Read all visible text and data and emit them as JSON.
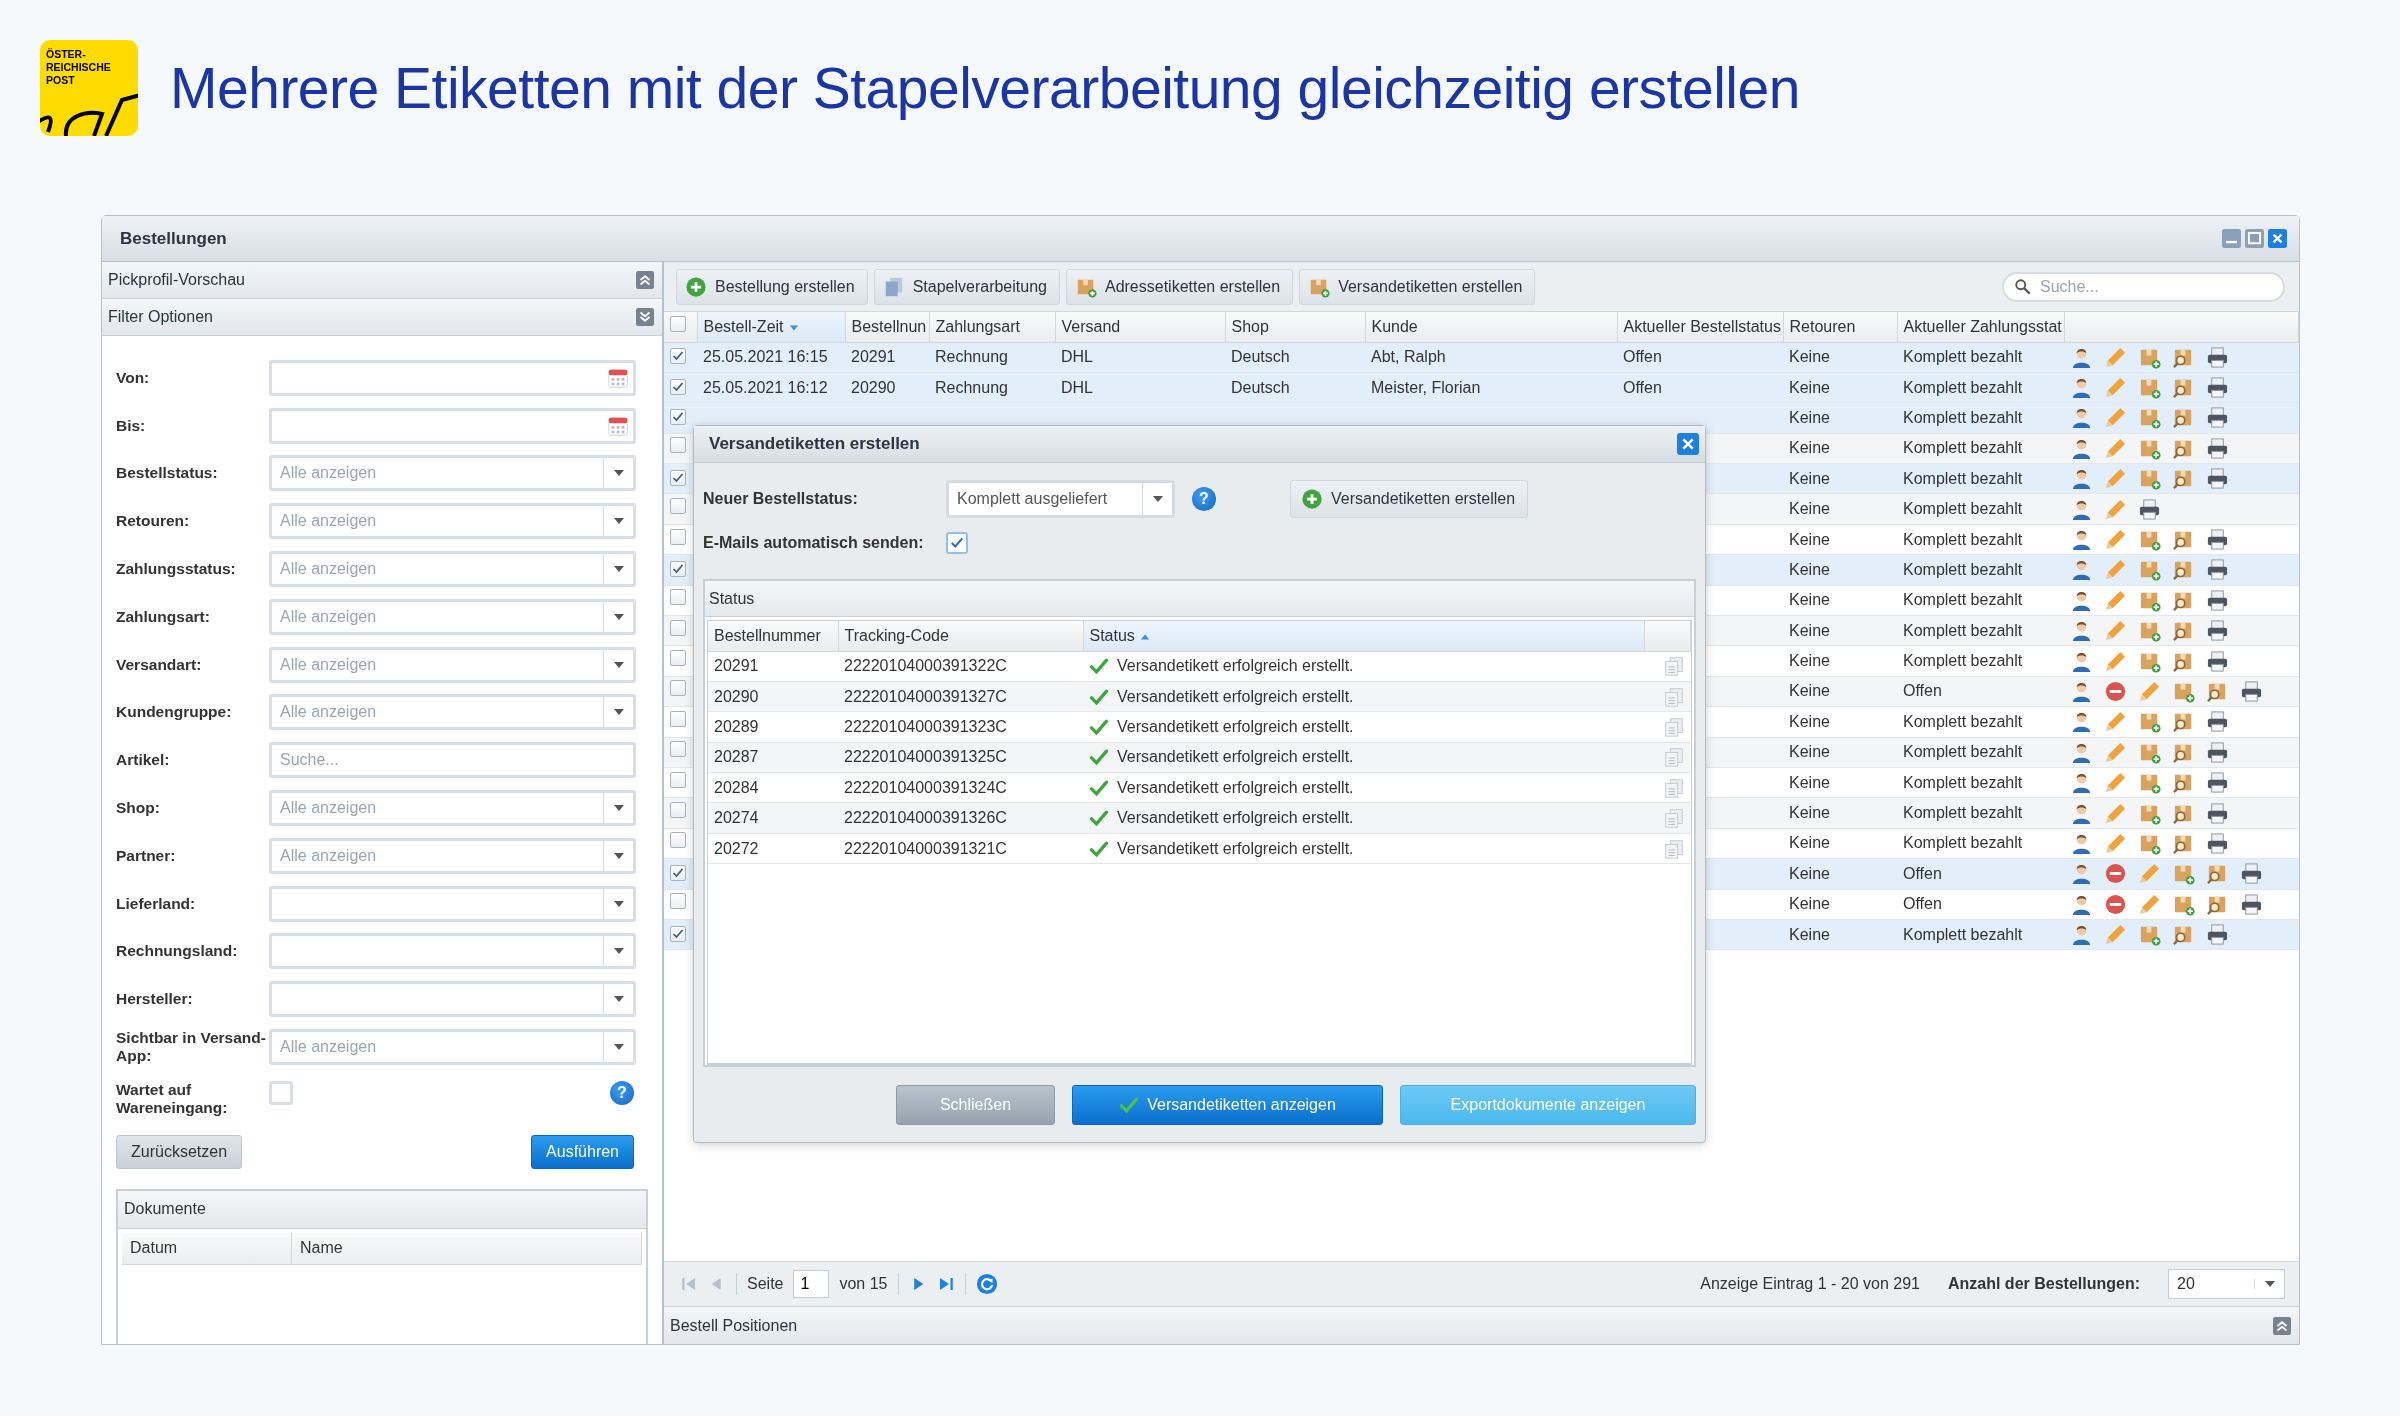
{
  "header": {
    "logo_lines": [
      "ÖSTER-",
      "REICHISCHE",
      "POST"
    ],
    "title": "Mehrere Etiketten mit der Stapelverarbeitung gleichzeitig erstellen"
  },
  "window": {
    "title": "Bestellungen"
  },
  "sidebar": {
    "panels": [
      {
        "title": "Pickprofil-Vorschau",
        "expanded": false
      },
      {
        "title": "Filter Optionen",
        "expanded": true
      }
    ],
    "filters": [
      {
        "label": "Von:",
        "kind": "date"
      },
      {
        "label": "Bis:",
        "kind": "date"
      },
      {
        "label": "Bestellstatus:",
        "kind": "select",
        "placeholder": "Alle anzeigen"
      },
      {
        "label": "Retouren:",
        "kind": "select",
        "placeholder": "Alle anzeigen"
      },
      {
        "label": "Zahlungsstatus:",
        "kind": "select",
        "placeholder": "Alle anzeigen"
      },
      {
        "label": "Zahlungsart:",
        "kind": "select",
        "placeholder": "Alle anzeigen"
      },
      {
        "label": "Versandart:",
        "kind": "select",
        "placeholder": "Alle anzeigen"
      },
      {
        "label": "Kundengruppe:",
        "kind": "select",
        "placeholder": "Alle anzeigen"
      },
      {
        "label": "Artikel:",
        "kind": "text",
        "placeholder": "Suche..."
      },
      {
        "label": "Shop:",
        "kind": "select",
        "placeholder": "Alle anzeigen"
      },
      {
        "label": "Partner:",
        "kind": "select",
        "placeholder": "Alle anzeigen"
      },
      {
        "label": "Lieferland:",
        "kind": "select"
      },
      {
        "label": "Rechnungsland:",
        "kind": "select"
      },
      {
        "label": "Hersteller:",
        "kind": "select"
      },
      {
        "label": "Sichtbar in Versand-App:",
        "kind": "select",
        "placeholder": "Alle anzeigen"
      },
      {
        "label": "Wartet auf Wareneingang:",
        "kind": "checkbox",
        "checked": false,
        "help": "?"
      }
    ],
    "buttons": [
      {
        "label": "Zurücksetzen",
        "kind": "default"
      },
      {
        "label": "Ausführen",
        "kind": "primary"
      }
    ],
    "documents": {
      "title": "Dokumente",
      "columns": [
        "Datum",
        "Name"
      ]
    }
  },
  "toolbar": {
    "buttons": [
      {
        "label": "Bestellung erstellen",
        "kind": "plus"
      },
      {
        "label": "Stapelverarbeitung",
        "kind": "pages"
      },
      {
        "label": "Adressetiketten erstellen",
        "kind": "package"
      },
      {
        "label": "Versandetiketten erstellen",
        "kind": "package"
      }
    ],
    "search": {
      "placeholder": "Suche..."
    }
  },
  "table": {
    "select_all_checked": false,
    "columns": [
      {
        "label": "Bestell-Zeit",
        "sorted": true,
        "descending": true
      },
      {
        "label": "Bestellnun",
        "sorted": false
      },
      {
        "label": "Zahlungsart",
        "sorted": false
      },
      {
        "label": "Versand",
        "sorted": false
      },
      {
        "label": "Shop",
        "sorted": false
      },
      {
        "label": "Kunde",
        "sorted": false
      },
      {
        "label": "Aktueller Bestellstatus",
        "sorted": false
      },
      {
        "label": "Retouren",
        "sorted": false
      },
      {
        "label": "Aktueller Zahlungsstat",
        "sorted": false
      }
    ],
    "rows": [
      {
        "checked": true,
        "bestell_zeit": "25.05.2021 16:15",
        "bestellnummer": "20291",
        "zahlungsart": "Rechnung",
        "versand": "DHL",
        "shop": "Deutsch",
        "kunde": "Abt, Ralph",
        "bestellstatus": "Offen",
        "retouren": "Keine",
        "zahlungsstatus": "Komplett bezahlt",
        "actions": [
          {
            "kind": "customer"
          },
          {
            "kind": "edit"
          },
          {
            "kind": "address-label"
          },
          {
            "kind": "shipping-label"
          },
          {
            "kind": "print"
          }
        ]
      },
      {
        "checked": true,
        "bestell_zeit": "25.05.2021 16:12",
        "bestellnummer": "20290",
        "zahlungsart": "Rechnung",
        "versand": "DHL",
        "shop": "Deutsch",
        "kunde": "Meister, Florian",
        "bestellstatus": "Offen",
        "retouren": "Keine",
        "zahlungsstatus": "Komplett bezahlt",
        "actions": [
          {
            "kind": "customer"
          },
          {
            "kind": "edit"
          },
          {
            "kind": "address-label"
          },
          {
            "kind": "shipping-label"
          },
          {
            "kind": "print"
          }
        ]
      },
      {
        "checked": true,
        "retouren": "Keine",
        "zahlungsstatus": "Komplett bezahlt",
        "actions": [
          {
            "kind": "customer"
          },
          {
            "kind": "edit"
          },
          {
            "kind": "address-label"
          },
          {
            "kind": "shipping-label"
          },
          {
            "kind": "print"
          }
        ]
      },
      {
        "checked": false,
        "retouren": "Keine",
        "zahlungsstatus": "Komplett bezahlt",
        "actions": [
          {
            "kind": "customer"
          },
          {
            "kind": "edit"
          },
          {
            "kind": "address-label"
          },
          {
            "kind": "shipping-label"
          },
          {
            "kind": "print"
          }
        ]
      },
      {
        "checked": true,
        "retouren": "Keine",
        "zahlungsstatus": "Komplett bezahlt",
        "actions": [
          {
            "kind": "customer"
          },
          {
            "kind": "edit"
          },
          {
            "kind": "address-label"
          },
          {
            "kind": "shipping-label"
          },
          {
            "kind": "print"
          }
        ]
      },
      {
        "checked": false,
        "retouren": "Keine",
        "zahlungsstatus": "Komplett bezahlt",
        "actions": [
          {
            "kind": "customer"
          },
          {
            "kind": "edit"
          },
          {
            "kind": "print"
          }
        ]
      },
      {
        "checked": false,
        "retouren": "Keine",
        "zahlungsstatus": "Komplett bezahlt",
        "actions": [
          {
            "kind": "customer"
          },
          {
            "kind": "edit"
          },
          {
            "kind": "address-label"
          },
          {
            "kind": "shipping-label"
          },
          {
            "kind": "print"
          }
        ]
      },
      {
        "checked": true,
        "retouren": "Keine",
        "zahlungsstatus": "Komplett bezahlt",
        "actions": [
          {
            "kind": "customer"
          },
          {
            "kind": "edit"
          },
          {
            "kind": "address-label"
          },
          {
            "kind": "shipping-label"
          },
          {
            "kind": "print"
          }
        ]
      },
      {
        "checked": false,
        "retouren": "Keine",
        "zahlungsstatus": "Komplett bezahlt",
        "actions": [
          {
            "kind": "customer"
          },
          {
            "kind": "edit"
          },
          {
            "kind": "address-label"
          },
          {
            "kind": "shipping-label"
          },
          {
            "kind": "print"
          }
        ]
      },
      {
        "checked": false,
        "retouren": "Keine",
        "zahlungsstatus": "Komplett bezahlt",
        "actions": [
          {
            "kind": "customer"
          },
          {
            "kind": "edit"
          },
          {
            "kind": "address-label"
          },
          {
            "kind": "shipping-label"
          },
          {
            "kind": "print"
          }
        ]
      },
      {
        "checked": false,
        "retouren": "Keine",
        "zahlungsstatus": "Komplett bezahlt",
        "actions": [
          {
            "kind": "customer"
          },
          {
            "kind": "edit"
          },
          {
            "kind": "address-label"
          },
          {
            "kind": "shipping-label"
          },
          {
            "kind": "print"
          }
        ]
      },
      {
        "checked": false,
        "retouren": "Keine",
        "zahlungsstatus": "Offen",
        "actions": [
          {
            "kind": "customer"
          },
          {
            "kind": "cancel"
          },
          {
            "kind": "edit"
          },
          {
            "kind": "address-label"
          },
          {
            "kind": "shipping-label"
          },
          {
            "kind": "print"
          }
        ]
      },
      {
        "checked": false,
        "retouren": "Keine",
        "zahlungsstatus": "Komplett bezahlt",
        "actions": [
          {
            "kind": "customer"
          },
          {
            "kind": "edit"
          },
          {
            "kind": "address-label"
          },
          {
            "kind": "shipping-label"
          },
          {
            "kind": "print"
          }
        ]
      },
      {
        "checked": false,
        "retouren": "Keine",
        "zahlungsstatus": "Komplett bezahlt",
        "actions": [
          {
            "kind": "customer"
          },
          {
            "kind": "edit"
          },
          {
            "kind": "address-label"
          },
          {
            "kind": "shipping-label"
          },
          {
            "kind": "print"
          }
        ]
      },
      {
        "checked": false,
        "retouren": "Keine",
        "zahlungsstatus": "Komplett bezahlt",
        "actions": [
          {
            "kind": "customer"
          },
          {
            "kind": "edit"
          },
          {
            "kind": "address-label"
          },
          {
            "kind": "shipping-label"
          },
          {
            "kind": "print"
          }
        ]
      },
      {
        "checked": false,
        "retouren": "Keine",
        "zahlungsstatus": "Komplett bezahlt",
        "actions": [
          {
            "kind": "customer"
          },
          {
            "kind": "edit"
          },
          {
            "kind": "address-label"
          },
          {
            "kind": "shipping-label"
          },
          {
            "kind": "print"
          }
        ]
      },
      {
        "checked": false,
        "retouren": "Keine",
        "zahlungsstatus": "Komplett bezahlt",
        "actions": [
          {
            "kind": "customer"
          },
          {
            "kind": "edit"
          },
          {
            "kind": "address-label"
          },
          {
            "kind": "shipping-label"
          },
          {
            "kind": "print"
          }
        ]
      },
      {
        "checked": true,
        "retouren": "Keine",
        "zahlungsstatus": "Offen",
        "actions": [
          {
            "kind": "customer"
          },
          {
            "kind": "cancel"
          },
          {
            "kind": "edit"
          },
          {
            "kind": "address-label"
          },
          {
            "kind": "shipping-label"
          },
          {
            "kind": "print"
          }
        ]
      },
      {
        "checked": false,
        "retouren": "Keine",
        "zahlungsstatus": "Offen",
        "actions": [
          {
            "kind": "customer"
          },
          {
            "kind": "cancel"
          },
          {
            "kind": "edit"
          },
          {
            "kind": "address-label"
          },
          {
            "kind": "shipping-label"
          },
          {
            "kind": "print"
          }
        ]
      },
      {
        "checked": true,
        "retouren": "Keine",
        "zahlungsstatus": "Komplett bezahlt",
        "actions": [
          {
            "kind": "customer"
          },
          {
            "kind": "edit"
          },
          {
            "kind": "address-label"
          },
          {
            "kind": "shipping-label"
          },
          {
            "kind": "print"
          }
        ]
      }
    ]
  },
  "pagination": {
    "nav": [
      {
        "kind": "first",
        "disabled": true
      },
      {
        "kind": "prev",
        "disabled": true
      },
      {
        "kind": "next",
        "disabled": false
      },
      {
        "kind": "last",
        "disabled": false
      }
    ],
    "page_label": "Seite",
    "page": "1",
    "of_label": "von 15",
    "info": "Anzeige Eintrag 1 - 20 von 291",
    "page_size_label": "Anzahl der Bestellungen:",
    "page_size": "20"
  },
  "bottom_panel": {
    "title": "Bestell Positionen",
    "expanded": false
  },
  "dialog": {
    "title": "Versandetiketten erstellen",
    "status_label": "Neuer Bestellstatus:",
    "status_value": "Komplett ausgeliefert",
    "help": "?",
    "create_button": "Versandetiketten erstellen",
    "email_label": "E-Mails automatisch senden:",
    "email_checked": true,
    "panel_title": "Status",
    "columns": [
      {
        "label": "Bestellnummer",
        "sorted": false
      },
      {
        "label": "Tracking-Code",
        "sorted": false
      },
      {
        "label": "Status",
        "sorted": true,
        "descending": false
      }
    ],
    "rows": [
      {
        "bestellnummer": "20291",
        "tracking_code": "22220104000391322C",
        "status": "Versandetikett erfolgreich erstellt.",
        "success": true
      },
      {
        "bestellnummer": "20290",
        "tracking_code": "22220104000391327C",
        "status": "Versandetikett erfolgreich erstellt.",
        "success": true
      },
      {
        "bestellnummer": "20289",
        "tracking_code": "22220104000391323C",
        "status": "Versandetikett erfolgreich erstellt.",
        "success": true
      },
      {
        "bestellnummer": "20287",
        "tracking_code": "22220104000391325C",
        "status": "Versandetikett erfolgreich erstellt.",
        "success": true
      },
      {
        "bestellnummer": "20284",
        "tracking_code": "22220104000391324C",
        "status": "Versandetikett erfolgreich erstellt.",
        "success": true
      },
      {
        "bestellnummer": "20274",
        "tracking_code": "22220104000391326C",
        "status": "Versandetikett erfolgreich erstellt.",
        "success": true
      },
      {
        "bestellnummer": "20272",
        "tracking_code": "22220104000391321C",
        "status": "Versandetikett erfolgreich erstellt.",
        "success": true
      }
    ],
    "buttons": [
      {
        "label": "Schließen",
        "kind": "muted"
      },
      {
        "label": "Versandetiketten anzeigen",
        "kind": "primary"
      },
      {
        "label": "Exportdokumente anzeigen",
        "kind": "info"
      }
    ]
  }
}
